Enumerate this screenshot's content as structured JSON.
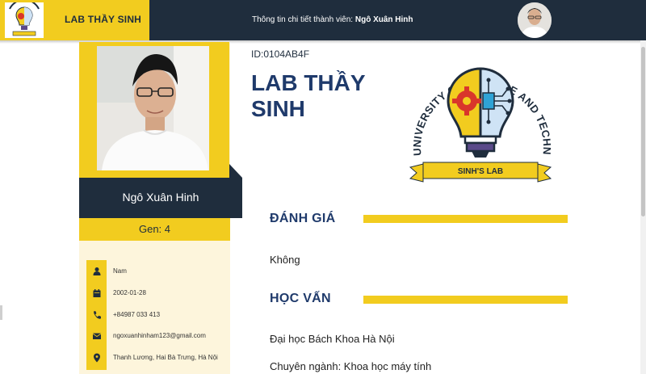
{
  "topbar": {
    "brand_text": "LAB THẦY SINH",
    "info_prefix": "Thông tin chi tiết thành viên:",
    "info_name": "Ngô Xuân Hinh"
  },
  "profile": {
    "name": "Ngô Xuân Hinh",
    "gen": "Gen: 4",
    "details": [
      {
        "icon": "user-icon",
        "value": "Nam"
      },
      {
        "icon": "calendar-icon",
        "value": "2002-01-28"
      },
      {
        "icon": "phone-icon",
        "value": "+84987 033 413"
      },
      {
        "icon": "envelope-icon",
        "value": "ngoxuanhinham123@gmail.com"
      },
      {
        "icon": "location-pin-icon",
        "value": "Thanh Lương, Hai Bà Trưng, Hà Nội"
      }
    ]
  },
  "main": {
    "member_id": "ID:0104AB4F",
    "title": "LAB THẦY SINH",
    "logo": {
      "arc_text": "HANOI UNIVERSITY OF SCIENCE AND TECHNOLOGY",
      "ribbon_text": "SINH'S LAB"
    },
    "sections": [
      {
        "heading": "ĐÁNH GIÁ",
        "lines": [
          "Không"
        ]
      },
      {
        "heading": "HỌC VẤN",
        "lines": [
          "Đại học Bách Khoa Hà Nội",
          "Chuyên ngành: Khoa học máy tính"
        ]
      }
    ]
  },
  "colors": {
    "navy": "#1f2d3d",
    "yellow": "#f2cc1f",
    "cream": "#fdf5dc",
    "heading_blue": "#1f3a6b"
  }
}
